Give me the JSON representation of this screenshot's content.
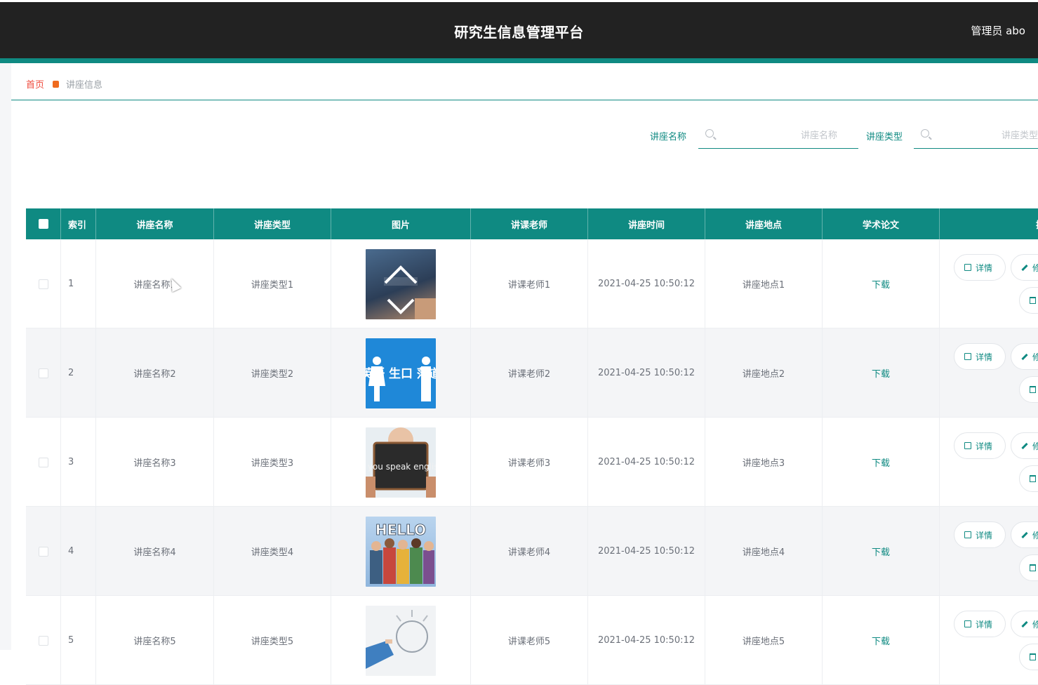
{
  "header": {
    "title": "研究生信息管理平台",
    "user": "管理员 abo"
  },
  "breadcrumb": {
    "home": "首页",
    "current": "讲座信息"
  },
  "search": [
    {
      "label": "讲座名称",
      "placeholder": "讲座名称"
    },
    {
      "label": "讲座类型",
      "placeholder": "讲座类型"
    }
  ],
  "table": {
    "headers": [
      "索引",
      "讲座名称",
      "讲座类型",
      "图片",
      "讲课老师",
      "讲座时间",
      "讲座地点",
      "学术论文",
      "操作"
    ],
    "rows": [
      {
        "index": "1",
        "name": "讲座名称1",
        "type": "讲座类型1",
        "teacher": "讲课老师1",
        "time": "2021-04-25 10:50:12",
        "place": "讲座地点1",
        "paper": "下载"
      },
      {
        "index": "2",
        "name": "讲座名称2",
        "type": "讲座类型2",
        "teacher": "讲课老师2",
        "time": "2021-04-25 10:50:12",
        "place": "讲座地点2",
        "paper": "下载"
      },
      {
        "index": "3",
        "name": "讲座名称3",
        "type": "讲座类型3",
        "teacher": "讲课老师3",
        "time": "2021-04-25 10:50:12",
        "place": "讲座地点3",
        "paper": "下载"
      },
      {
        "index": "4",
        "name": "讲座名称4",
        "type": "讲座类型4",
        "teacher": "讲课老师4",
        "time": "2021-04-25 10:50:12",
        "place": "讲座地点4",
        "paper": "下载"
      },
      {
        "index": "5",
        "name": "讲座名称5",
        "type": "讲座类型5",
        "teacher": "讲课老师5",
        "time": "2021-04-25 10:50:12",
        "place": "讲座地点5",
        "paper": "下载"
      }
    ],
    "actions": {
      "detail": "详情",
      "edit": "修",
      "delete": "删"
    }
  },
  "images": {
    "img2_text": "英语 生口 落道",
    "img3_text": "Do you speak english?",
    "img4_text": "HELLO"
  },
  "colors": {
    "accent": "#0f8a82",
    "topbar": "#222222",
    "breadcrumb_home": "#ef4b3d"
  }
}
